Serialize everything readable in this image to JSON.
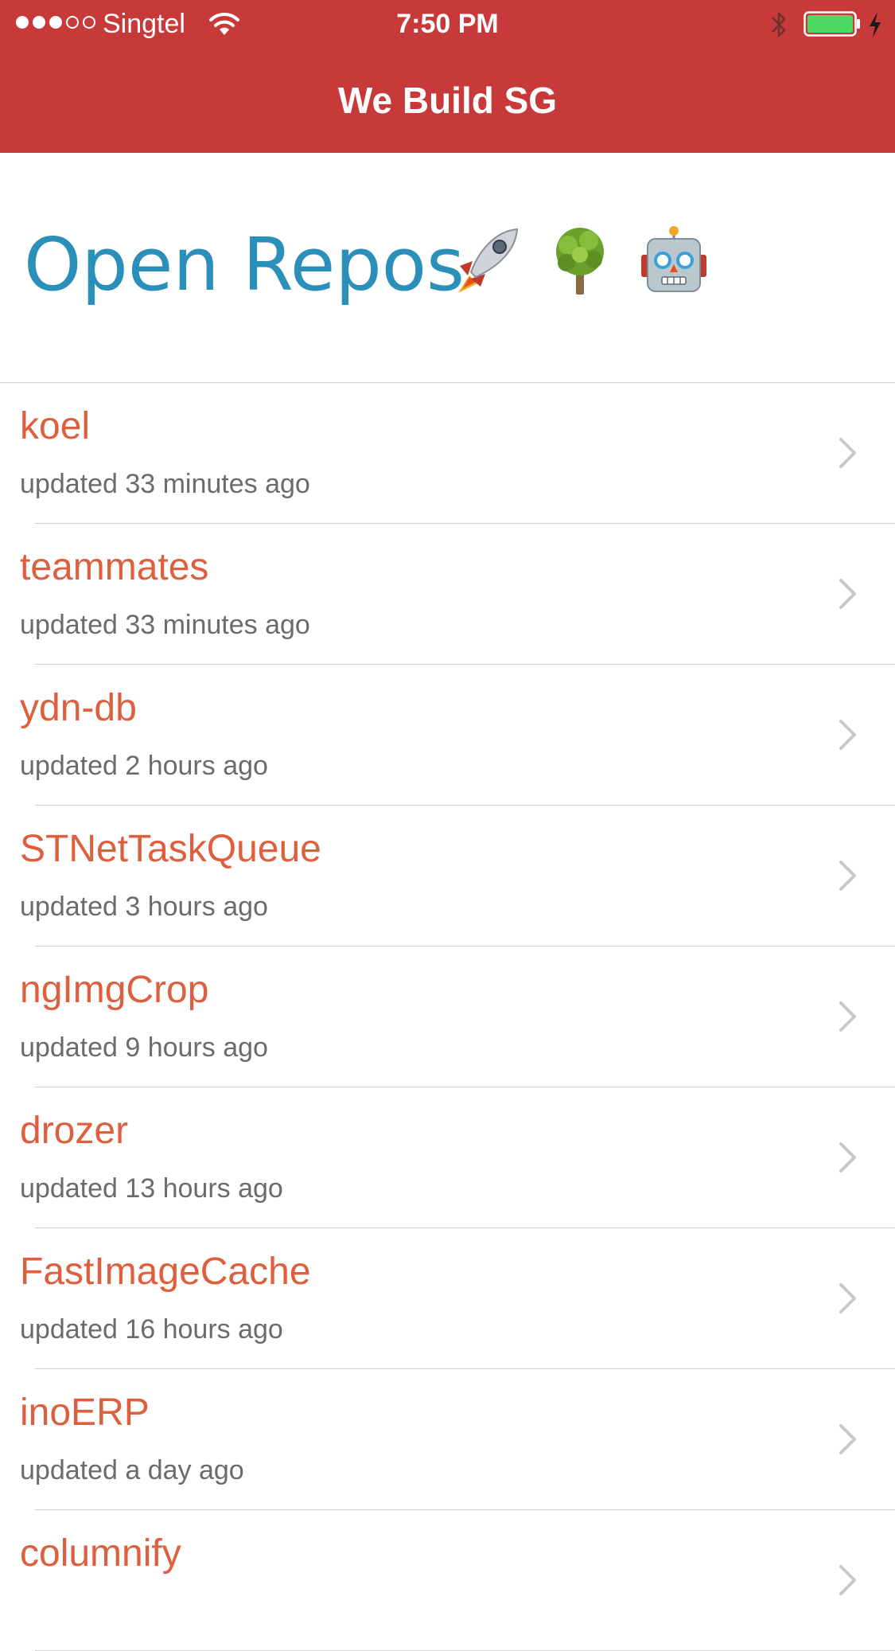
{
  "status_bar": {
    "carrier": "Singtel",
    "signal_bars_filled": 3,
    "signal_bars_total": 5,
    "time": "7:50 PM",
    "battery_level": 1.0,
    "battery_color": "#4cd964",
    "icons": [
      "wifi-icon",
      "bluetooth-icon",
      "battery-icon",
      "charging-icon"
    ]
  },
  "nav": {
    "title": "We Build SG",
    "background_color": "#c83a3a"
  },
  "header": {
    "title": "Open Repos",
    "title_color": "#2a8fb9",
    "emoji_icons": [
      "rocket-icon",
      "tree-icon",
      "robot-icon"
    ]
  },
  "repos": [
    {
      "name": "koel",
      "updated": "updated 33 minutes ago"
    },
    {
      "name": "teammates",
      "updated": "updated 33 minutes ago"
    },
    {
      "name": "ydn-db",
      "updated": "updated 2 hours ago"
    },
    {
      "name": "STNetTaskQueue",
      "updated": "updated 3 hours ago"
    },
    {
      "name": "ngImgCrop",
      "updated": "updated 9 hours ago"
    },
    {
      "name": "drozer",
      "updated": "updated 13 hours ago"
    },
    {
      "name": "FastImageCache",
      "updated": "updated 16 hours ago"
    },
    {
      "name": "inoERP",
      "updated": "updated a day ago"
    },
    {
      "name": "columnify",
      "updated": ""
    }
  ],
  "colors": {
    "repo_name": "#dd5f3d",
    "repo_meta": "#6b6b6b",
    "separator": "#d0d0d0",
    "chevron": "#c7c7cc"
  }
}
